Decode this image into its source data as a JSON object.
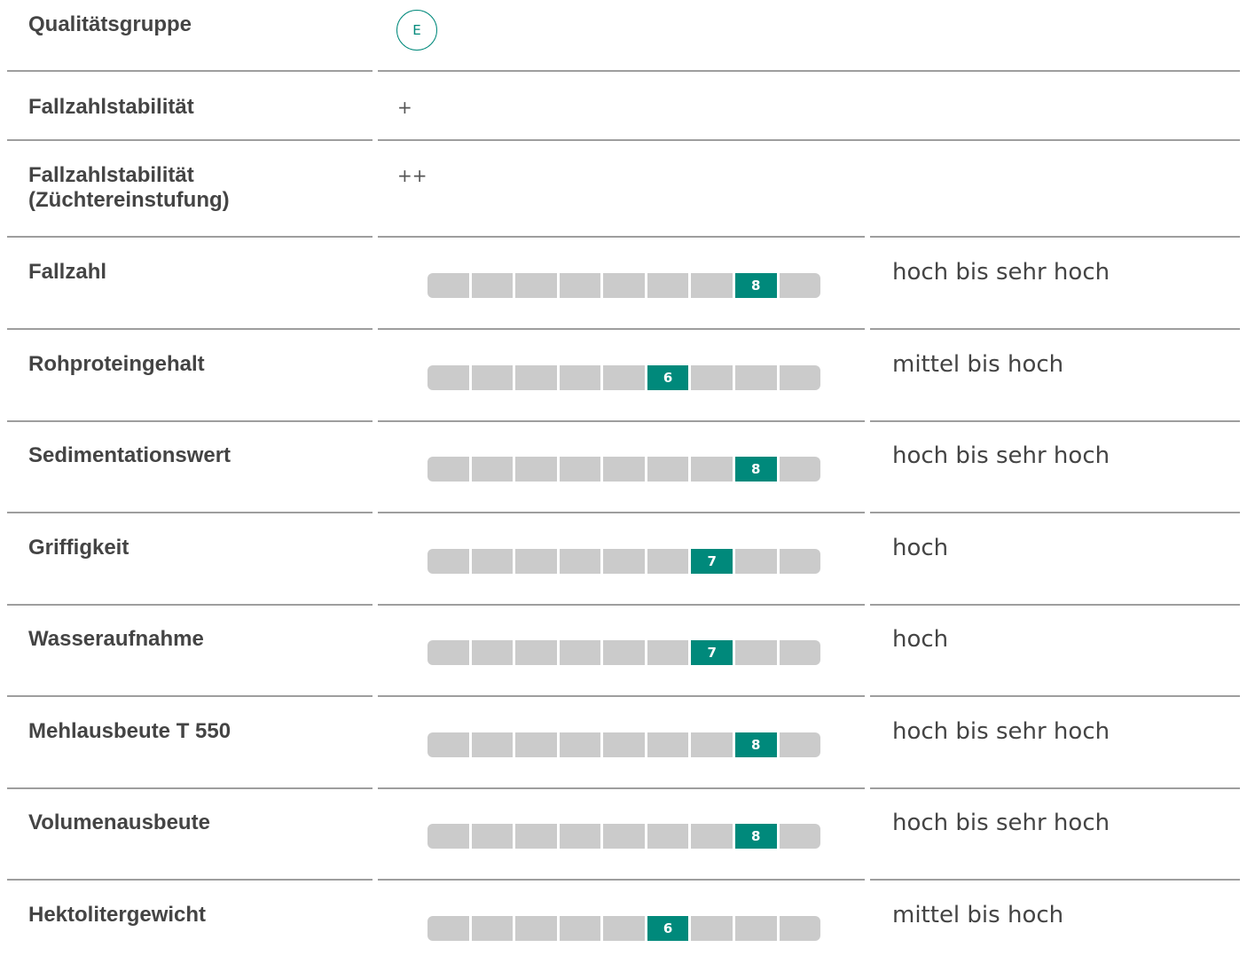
{
  "top_rows": [
    {
      "label": "Qualitätsgruppe",
      "badge": "E"
    },
    {
      "label": "Fallzahlstabilität",
      "value": "+"
    },
    {
      "label": "Fallzahlstabilität (Züchtereinstufung)",
      "value": "++"
    }
  ],
  "scale_max": 9,
  "accent_color": "#00897b",
  "inactive_color": "#cbcbcb",
  "rated_rows": [
    {
      "label": "Fallzahl",
      "score": 8,
      "description": "hoch bis sehr hoch"
    },
    {
      "label": "Rohproteingehalt",
      "score": 6,
      "description": "mittel bis hoch"
    },
    {
      "label": "Sedimentationswert",
      "score": 8,
      "description": "hoch bis sehr hoch"
    },
    {
      "label": "Griffigkeit",
      "score": 7,
      "description": "hoch"
    },
    {
      "label": "Wasseraufnahme",
      "score": 7,
      "description": "hoch"
    },
    {
      "label": "Mehlausbeute T 550",
      "score": 8,
      "description": "hoch bis sehr hoch"
    },
    {
      "label": "Volumenausbeute",
      "score": 8,
      "description": "hoch bis sehr hoch"
    },
    {
      "label": "Hektolitergewicht",
      "score": 6,
      "description": "mittel bis hoch"
    }
  ]
}
